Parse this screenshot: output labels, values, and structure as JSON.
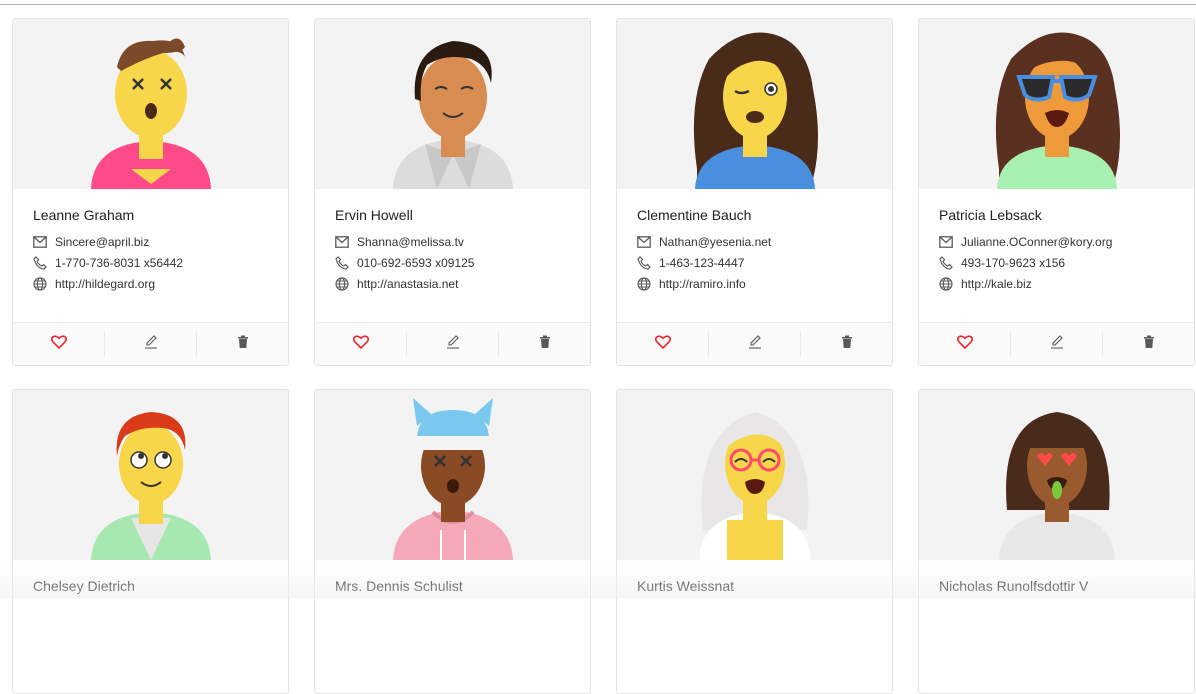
{
  "users": [
    {
      "name": "Leanne Graham",
      "email": "Sincere@april.biz",
      "phone": "1-770-736-8031 x56442",
      "website": "http://hildegard.org",
      "skin": "#f7d64a",
      "hair": "#7a4a2a",
      "shirt": "#ff4a8a"
    },
    {
      "name": "Ervin Howell",
      "email": "Shanna@melissa.tv",
      "phone": "010-692-6593 x09125",
      "website": "http://anastasia.net",
      "skin": "#d88c52",
      "hair": "#2a1a10",
      "shirt": "#e0e0e0"
    },
    {
      "name": "Clementine Bauch",
      "email": "Nathan@yesenia.net",
      "phone": "1-463-123-4447",
      "website": "http://ramiro.info",
      "skin": "#f7d64a",
      "hair": "#4a2a18",
      "shirt": "#4a8ee0"
    },
    {
      "name": "Patricia Lebsack",
      "email": "Julianne.OConner@kory.org",
      "phone": "493-170-9623 x156",
      "website": "http://kale.biz",
      "skin": "#ef9a3a",
      "hair": "#5a3020",
      "shirt": "#a8f0b0"
    },
    {
      "name": "Chelsey Dietrich",
      "email": "",
      "phone": "",
      "website": "",
      "skin": "#f7d64a",
      "hair": "#d83a1a",
      "shirt": "#a6e8b0"
    },
    {
      "name": "Mrs. Dennis Schulist",
      "email": "",
      "phone": "",
      "website": "",
      "skin": "#8a4a24",
      "hair": "#7ac8f0",
      "shirt": "#f5a8b8"
    },
    {
      "name": "Kurtis Weissnat",
      "email": "",
      "phone": "",
      "website": "",
      "skin": "#f7d64a",
      "hair": "#e8e6e6",
      "shirt": "#f7d64a"
    },
    {
      "name": "Nicholas Runolfsdottir V",
      "email": "",
      "phone": "",
      "website": "",
      "skin": "#9a5a30",
      "hair": "#4a2a1a",
      "shirt": "#e8e8e8"
    }
  ],
  "colors": {
    "heart": "#f5222d",
    "icon": "#595959",
    "accent": "#b9a6d6"
  },
  "icons": {
    "email": "mail-icon",
    "phone": "phone-icon",
    "website": "globe-icon",
    "like": "heart-icon",
    "edit": "edit-icon",
    "delete": "trash-icon"
  }
}
